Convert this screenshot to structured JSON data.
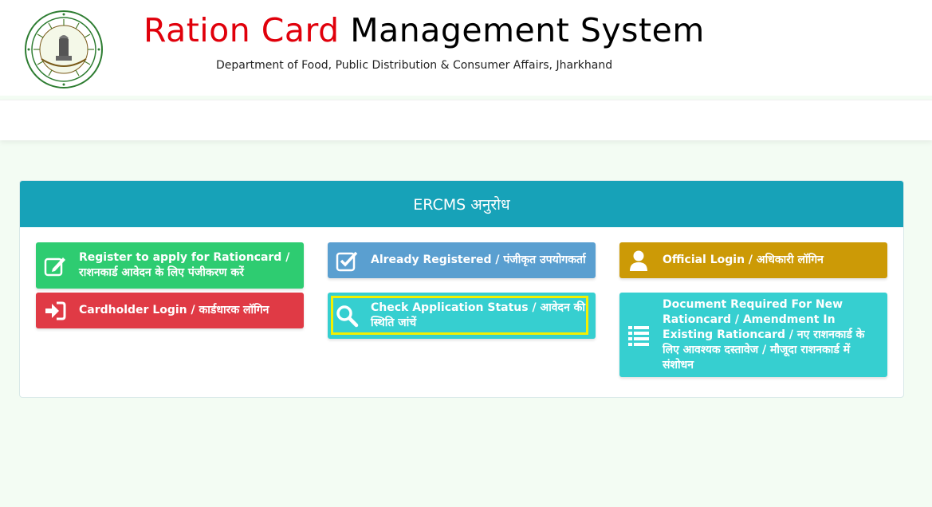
{
  "header": {
    "title_red": "Ration Card",
    "title_black": "Management System",
    "subtitle": "Department of Food, Public Distribution & Consumer Affairs, Jharkhand",
    "emblem_top_text": "झारखण्ड सरकार",
    "emblem_bottom_text": "GOVERNMENT OF JHARKHAND"
  },
  "panel": {
    "title": "ERCMS अनुरोध"
  },
  "buttons": {
    "register": {
      "label": "Register to apply for Rationcard / राशनकार्ड आवेदन के लिए पंजीकरण करें",
      "icon": "edit-icon",
      "color": "#2ecc71"
    },
    "cardholder": {
      "label": "Cardholder Login / कार्डधारक लॉगिन",
      "icon": "sign-in-icon",
      "color": "#e03a45"
    },
    "registered": {
      "label": "Already Registered / पंजीकृत उपयोगकर्ता",
      "icon": "check-square-icon",
      "color": "#5a9fd0"
    },
    "status": {
      "label": "Check Application Status / आवेदन की स्थिति जांचें",
      "icon": "search-icon",
      "color": "#36cfd0"
    },
    "official": {
      "label": "Official Login / अधिकारी लॉगिन",
      "icon": "user-icon",
      "color": "#cc9a06"
    },
    "documents": {
      "label": "Document Required For New Rationcard / Amendment In Existing Rationcard / नए राशनकार्ड के लिए आवश्यक दस्तावेज / मौजूदा राशनकार्ड में संशोधन",
      "icon": "list-icon",
      "color": "#36cfd0"
    }
  },
  "colors": {
    "accent": "#17a2b8",
    "highlight": "#f4f000",
    "title_red": "#e0000b"
  }
}
